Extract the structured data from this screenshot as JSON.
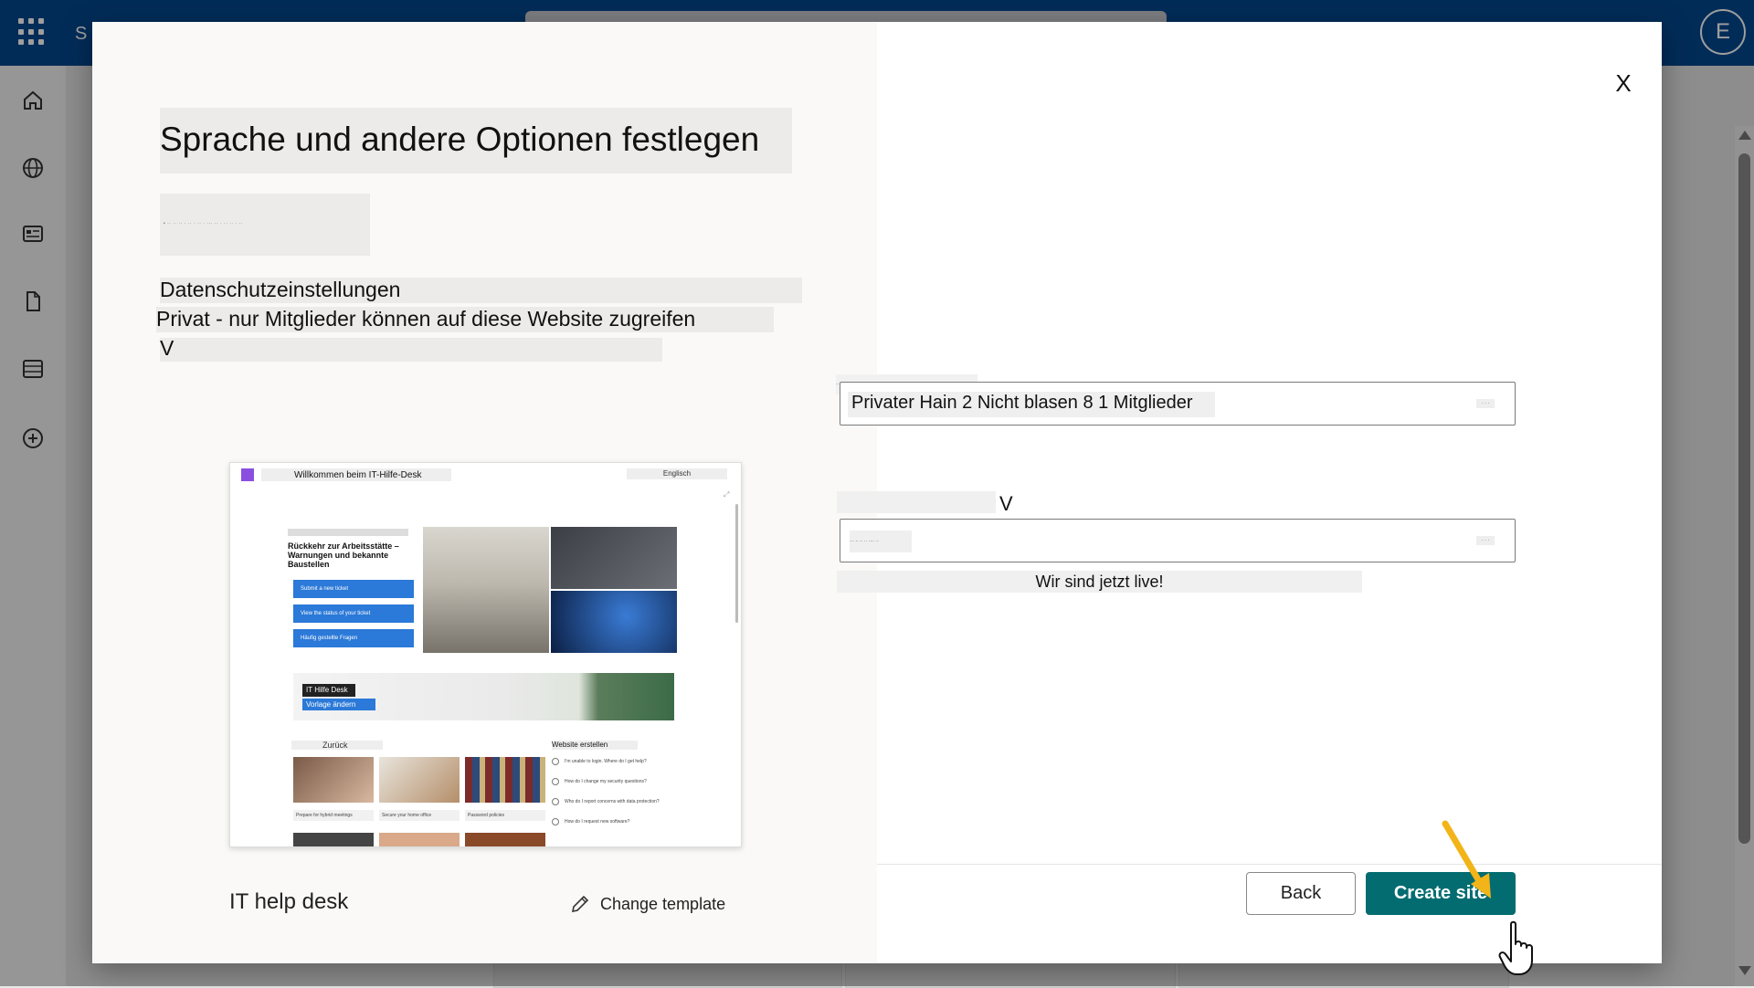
{
  "app": {
    "letter": "S",
    "user_initial": "E",
    "brand_color": "#04478e"
  },
  "nav_rail": [
    "home-icon",
    "globe-icon",
    "news-icon",
    "document-icon",
    "list-icon",
    "add-icon"
  ],
  "dialog": {
    "close_label": "X",
    "title": "Sprache und andere Optionen festlegen",
    "obscured_caption": "• ·· ·· ·· · ·· · ·· · ··· ·· · ·· ·· · ··",
    "privacy": {
      "label": "Datenschutzeinstellungen",
      "value": "Privat - nur Mitglieder können auf diese Website zugreifen",
      "chevron": "V"
    },
    "template": {
      "name": "IT help desk",
      "change_label": "Change template",
      "preview": {
        "site_title": "Willkommen beim IT-Hilfe-Desk",
        "language": "Englisch",
        "hero_heading": "Rückkehr zur Arbeitsstätte – Warnungen und bekannte Baustellen",
        "buttons": [
          "Submit a new ticket",
          "View the status of your ticket",
          "Häufig gestellte Fragen"
        ],
        "banner_title": "IT Hilfe Desk",
        "banner_button": "Vorlage ändern",
        "section_left": "Zurück",
        "section_right": "Website erstellen",
        "cards": [
          "Prepare for hybrid meetings",
          "Secure your home office",
          "Password policies"
        ],
        "faq": [
          "I'm unable to login. Where do I get help?",
          "How do I change my security questions?",
          "Who do I report concerns with data protection?",
          "How do I request new software?"
        ]
      }
    },
    "right": {
      "obscured_label": "·· ··· ···· ·· ··· ·· ···· ·· ·· ·· · ·· ····",
      "field1_value": "Privater Hain 2 Nicht blasen 8 1 Mitglieder",
      "field_button": "· · ·",
      "chevron": "V",
      "field2_value": "··· ·· ·· ·· ···· ··",
      "live_text": "Wir sind jetzt live!"
    },
    "buttons": {
      "back": "Back",
      "create": "Create site"
    },
    "colors": {
      "create_button": "#036c70",
      "arrow": "#f2b418"
    }
  }
}
